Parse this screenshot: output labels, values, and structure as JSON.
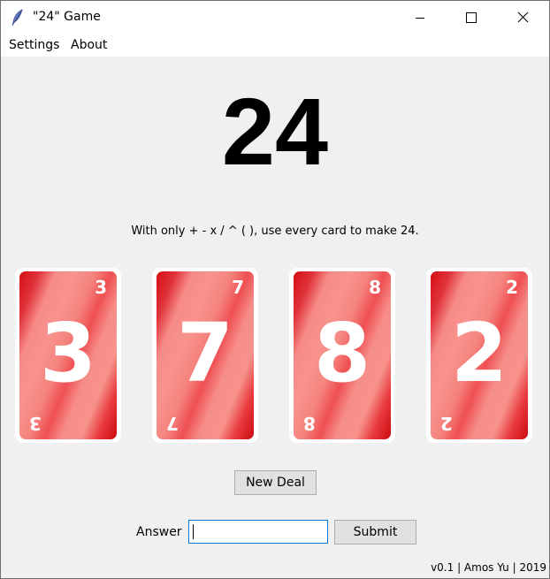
{
  "window": {
    "title": "\"24\" Game"
  },
  "menu": {
    "items": [
      {
        "label": "Settings"
      },
      {
        "label": "About"
      }
    ]
  },
  "game": {
    "target": "24",
    "instructions": "With only + - x / ^ ( ), use every card to make 24.",
    "cards": [
      {
        "value": "3"
      },
      {
        "value": "7"
      },
      {
        "value": "8"
      },
      {
        "value": "2"
      }
    ],
    "card_color": "#e0111a"
  },
  "controls": {
    "new_deal_label": "New Deal",
    "answer_label": "Answer",
    "answer_value": "",
    "submit_label": "Submit"
  },
  "footer": {
    "text": "v0.1 | Amos Yu | 2019"
  },
  "icons": {
    "app": "feather-icon",
    "minimize": "minimize-icon",
    "maximize": "maximize-icon",
    "close": "close-icon"
  }
}
